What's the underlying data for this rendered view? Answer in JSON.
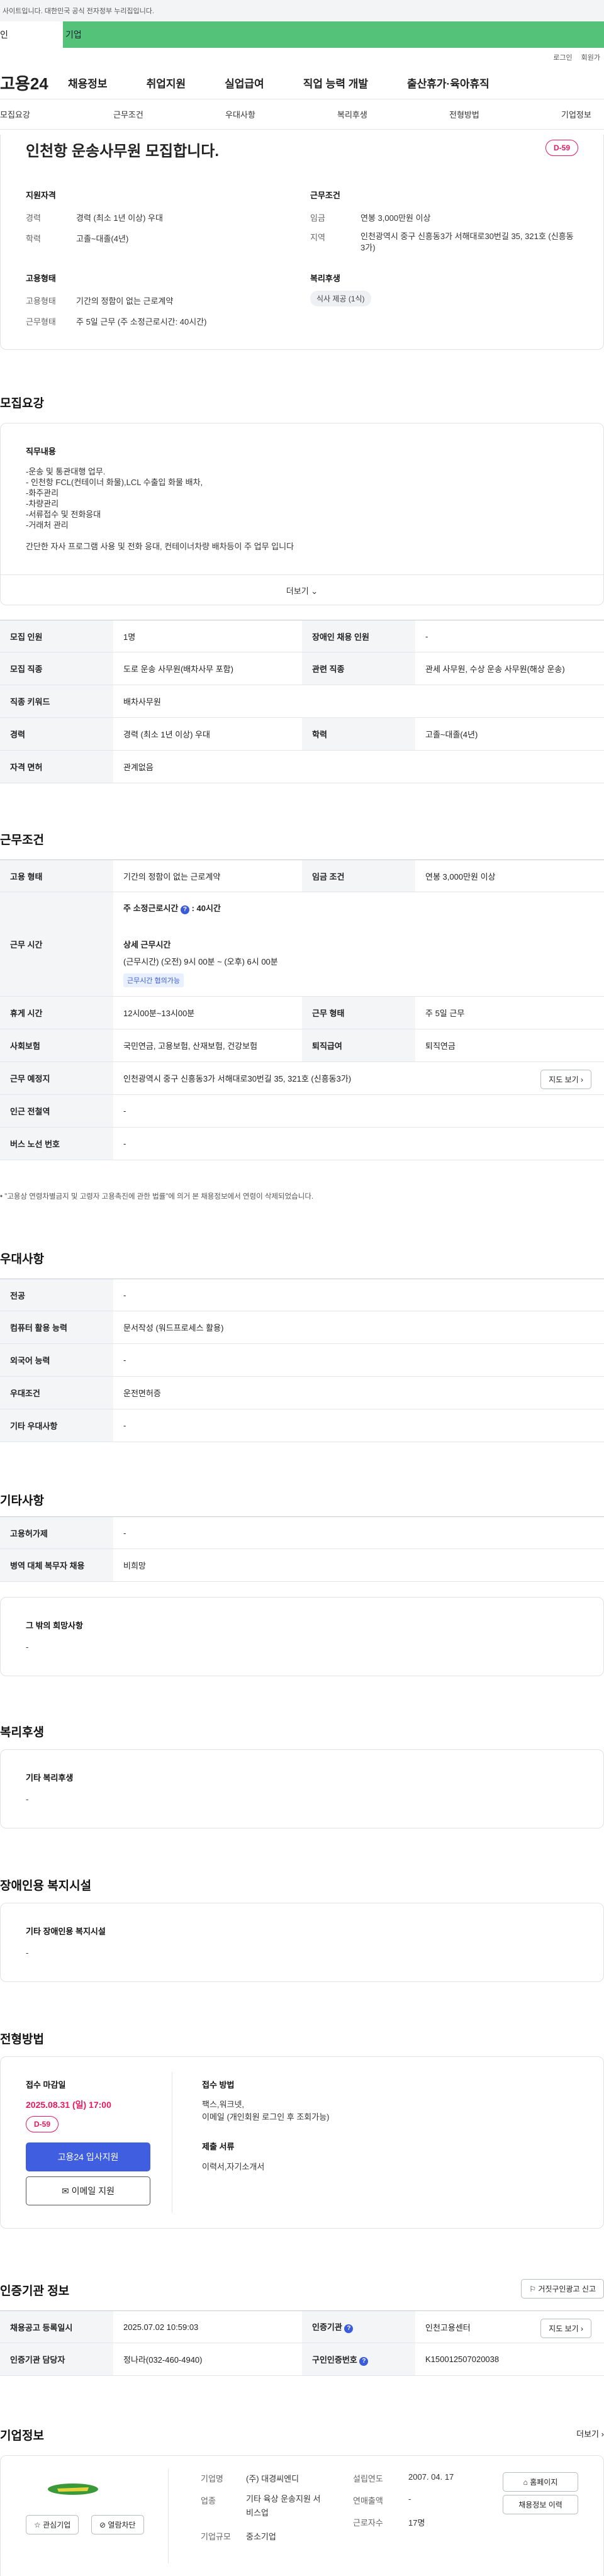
{
  "gov_notice": "사이트입니다. 대한민국 공식 전자정부 누리집입니다.",
  "user_tabs": [
    "인",
    "기업"
  ],
  "util": [
    "로그인",
    "회원가"
  ],
  "logo": "고용24",
  "gnb": [
    "채용정보",
    "취업지원",
    "실업급여",
    "직업 능력 개발",
    "출산휴가·육아휴직"
  ],
  "subnav": [
    "모집요강",
    "근무조건",
    "우대사항",
    "복리후생",
    "전형방법",
    "기업정보"
  ],
  "summary": {
    "title": "인천항 운송사무원 모집합니다.",
    "dday": "D-59",
    "qual_title": "지원자격",
    "qual": [
      {
        "k": "경력",
        "v": "경력 (최소 1년 이상) 우대"
      },
      {
        "k": "학력",
        "v": "고졸~대졸(4년)"
      }
    ],
    "cond_title": "근무조건",
    "cond": [
      {
        "k": "임금",
        "v": "연봉 3,000만원 이상"
      },
      {
        "k": "지역",
        "v": "인천광역시 중구 신흥동3가 서해대로30번길 35, 321호 (신흥동3가)"
      }
    ],
    "emp_title": "고용형태",
    "emp": [
      {
        "k": "고용형태",
        "v": "기간의 정함이 없는 근로계약"
      },
      {
        "k": "근무형태",
        "v": "주 5일 근무 (주 소정근로시간: 40시간)"
      }
    ],
    "welfare_title": "복리후생",
    "welfare_pill": "식사 제공 (1식)"
  },
  "recruit": {
    "title": "모집요강",
    "duty_label": "직무내용",
    "duty_lines": [
      "-운송 및 통관대행 업무.",
      "- 인천항  FCL(컨테이너 화물),LCL 수출입 화물  배차,",
      "-화주관리",
      "-차량관리",
      "-서류접수 및 전화응대",
      "-거래처 관리",
      "",
      "간단한 자사 프로그램 사용 및 전화 응대, 컨테이너차량 배차등이 주 업무 입니다"
    ],
    "more": "더보기",
    "rows": [
      [
        "모집 인원",
        "1명",
        "장애인 채용 인원",
        "-"
      ],
      [
        "모집 직종",
        "도로 운송 사무원(배차사무 포함)",
        "관련 직종",
        "관세 사무원, 수상 운송 사무원(해상 운송)"
      ],
      [
        "직종 키워드",
        "배차사무원"
      ],
      [
        "경력",
        "경력 (최소 1년 이상) 우대",
        "학력",
        "고졸~대졸(4년)"
      ],
      [
        "자격 면허",
        "관계없음"
      ]
    ]
  },
  "work": {
    "title": "근무조건",
    "emp_type_k": "고용 형태",
    "emp_type_v": "기간의 정함이 없는 근로계약",
    "wage_k": "임금 조건",
    "wage_v": "연봉 3,000만원 이상",
    "hours_k": "근무 시간",
    "hours_total": "주 소정근로시간",
    "hours_total_v": "40시간",
    "hours_detail_title": "상세 근무시간",
    "hours_detail": "(근무시간) (오전) 9시 00분 ~ (오후) 6시 00분",
    "hours_tag": "근무시간 협의가능",
    "break_k": "휴게 시간",
    "break_v": "12시00분~13시00분",
    "form_k": "근무 형태",
    "form_v": "주 5일 근무",
    "ins_k": "사회보험",
    "ins_v": "국민연금, 고용보험, 산재보험, 건강보험",
    "ret_k": "퇴직급여",
    "ret_v": "퇴직연금",
    "place_k": "근무 예정지",
    "place_v": "인천광역시 중구 신흥동3가 서해대로30번길 35, 321호 (신흥동3가)",
    "map_btn": "지도 보기",
    "subway_k": "인근 전철역",
    "subway_v": "-",
    "bus_k": "버스 노선 번호",
    "bus_v": "-",
    "notice": "\"고용상 연령차별금지 및 고령자 고용촉진에 관한 법률\"에 의거 본 채용정보에서 연령이 삭제되었습니다."
  },
  "pref": {
    "title": "우대사항",
    "rows": [
      [
        "전공",
        "-"
      ],
      [
        "컴퓨터 활용 능력",
        "문서작성 (워드프로세스 활용)"
      ],
      [
        "외국어 능력",
        "-"
      ],
      [
        "우대조건",
        "운전면허증"
      ],
      [
        "기타 우대사항",
        "-"
      ]
    ]
  },
  "etc": {
    "title": "기타사항",
    "rows": [
      [
        "고용허가제",
        "-"
      ],
      [
        "병역 대체 복무자 채용",
        "비희망"
      ]
    ],
    "other_label": "그 밖의 희망사항",
    "other_v": "-"
  },
  "benefit": {
    "title": "복리후생",
    "label": "기타 복리후생",
    "v": "-"
  },
  "disabled": {
    "title": "장애인용 복지시설",
    "label": "기타 장애인용 복지시설",
    "v": "-"
  },
  "selection": {
    "title": "전형방법",
    "deadline_label": "접수 마감일",
    "deadline": "2025.08.31 (일) 17:00",
    "dday": "D-59",
    "apply_btn": "고용24 입사지원",
    "email_btn": "이메일 지원",
    "method_label": "접수 방법",
    "method_v1": "팩스,워크넷,",
    "method_v2": "이메일 (개인회원 로그인 후 조회가능)",
    "docs_label": "제출 서류",
    "docs_v": "이력서,자기소개서"
  },
  "cert": {
    "title": "인증기관 정보",
    "report_btn": "거짓구인광고 신고",
    "rows": [
      [
        "채용공고 등록일시",
        "2025.07.02 10:59:03",
        "인증기관",
        "인천고용센터"
      ],
      [
        "인증기관 담당자",
        "정나라(032-460-4940)",
        "구인인증번호",
        "K150012507020038"
      ]
    ],
    "map_btn": "지도 보기"
  },
  "company": {
    "title": "기업정보",
    "more": "더보기",
    "fav_btn": "관심기업",
    "block_btn": "열람차단",
    "rows": [
      [
        "기업명",
        "(주) 대경씨엔디"
      ],
      [
        "업종",
        "기타 육상 운송지원 서비스업"
      ],
      [
        "기업규모",
        "중소기업"
      ]
    ],
    "rows2": [
      [
        "설립연도",
        "2007. 04. 17"
      ],
      [
        "연매출액",
        "-"
      ],
      [
        "근로자수",
        "17명"
      ]
    ],
    "home_btn": "홈페이지",
    "history_btn": "채용정보 이력"
  }
}
